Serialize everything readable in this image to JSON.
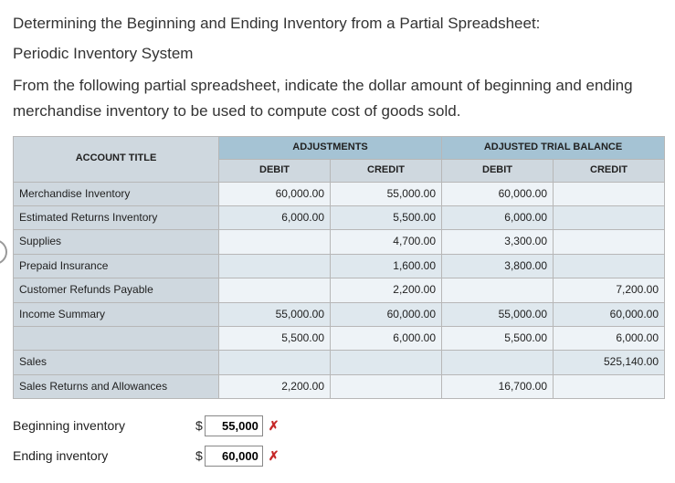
{
  "intro": {
    "title_line1": "Determining the Beginning and Ending Inventory from a Partial Spreadsheet:",
    "title_line2": "Periodic Inventory System",
    "para": "From the following partial spreadsheet, indicate the dollar amount of beginning and ending merchandise inventory to be used to compute cost of goods sold."
  },
  "headers": {
    "account_title": "ACCOUNT TITLE",
    "adjustments": "ADJUSTMENTS",
    "adjusted_trial_balance": "ADJUSTED TRIAL BALANCE",
    "debit": "DEBIT",
    "credit": "CREDIT"
  },
  "rows": [
    {
      "label": "Merchandise Inventory",
      "adj_d": "60,000.00",
      "adj_c": "55,000.00",
      "atb_d": "60,000.00",
      "atb_c": ""
    },
    {
      "label": "Estimated Returns Inventory",
      "adj_d": "6,000.00",
      "adj_c": "5,500.00",
      "atb_d": "6,000.00",
      "atb_c": ""
    },
    {
      "label": "Supplies",
      "adj_d": "",
      "adj_c": "4,700.00",
      "atb_d": "3,300.00",
      "atb_c": ""
    },
    {
      "label": "Prepaid Insurance",
      "adj_d": "",
      "adj_c": "1,600.00",
      "atb_d": "3,800.00",
      "atb_c": ""
    },
    {
      "label": "Customer Refunds Payable",
      "adj_d": "",
      "adj_c": "2,200.00",
      "atb_d": "",
      "atb_c": "7,200.00"
    },
    {
      "label": "Income Summary",
      "adj_d": "55,000.00",
      "adj_c": "60,000.00",
      "atb_d": "55,000.00",
      "atb_c": "60,000.00"
    },
    {
      "label": "",
      "adj_d": "5,500.00",
      "adj_c": "6,000.00",
      "atb_d": "5,500.00",
      "atb_c": "6,000.00"
    },
    {
      "label": "Sales",
      "adj_d": "",
      "adj_c": "",
      "atb_d": "",
      "atb_c": "525,140.00"
    },
    {
      "label": "Sales Returns and Allowances",
      "adj_d": "2,200.00",
      "adj_c": "",
      "atb_d": "16,700.00",
      "atb_c": ""
    }
  ],
  "answers": {
    "beginning_label": "Beginning inventory",
    "ending_label": "Ending inventory",
    "currency": "$",
    "beginning_value": "55,000",
    "ending_value": "60,000",
    "mark": "✗"
  },
  "chart_data": {
    "type": "table",
    "title": "Partial Spreadsheet — Adjustments and Adjusted Trial Balance",
    "columns": [
      "Account Title",
      "Adjustments Debit",
      "Adjustments Credit",
      "Adjusted Trial Balance Debit",
      "Adjusted Trial Balance Credit"
    ],
    "rows": [
      [
        "Merchandise Inventory",
        60000.0,
        55000.0,
        60000.0,
        null
      ],
      [
        "Estimated Returns Inventory",
        6000.0,
        5500.0,
        6000.0,
        null
      ],
      [
        "Supplies",
        null,
        4700.0,
        3300.0,
        null
      ],
      [
        "Prepaid Insurance",
        null,
        1600.0,
        3800.0,
        null
      ],
      [
        "Customer Refunds Payable",
        null,
        2200.0,
        null,
        7200.0
      ],
      [
        "Income Summary",
        55000.0,
        60000.0,
        55000.0,
        60000.0
      ],
      [
        "",
        5500.0,
        6000.0,
        5500.0,
        6000.0
      ],
      [
        "Sales",
        null,
        null,
        null,
        525140.0
      ],
      [
        "Sales Returns and Allowances",
        2200.0,
        null,
        16700.0,
        null
      ]
    ]
  }
}
